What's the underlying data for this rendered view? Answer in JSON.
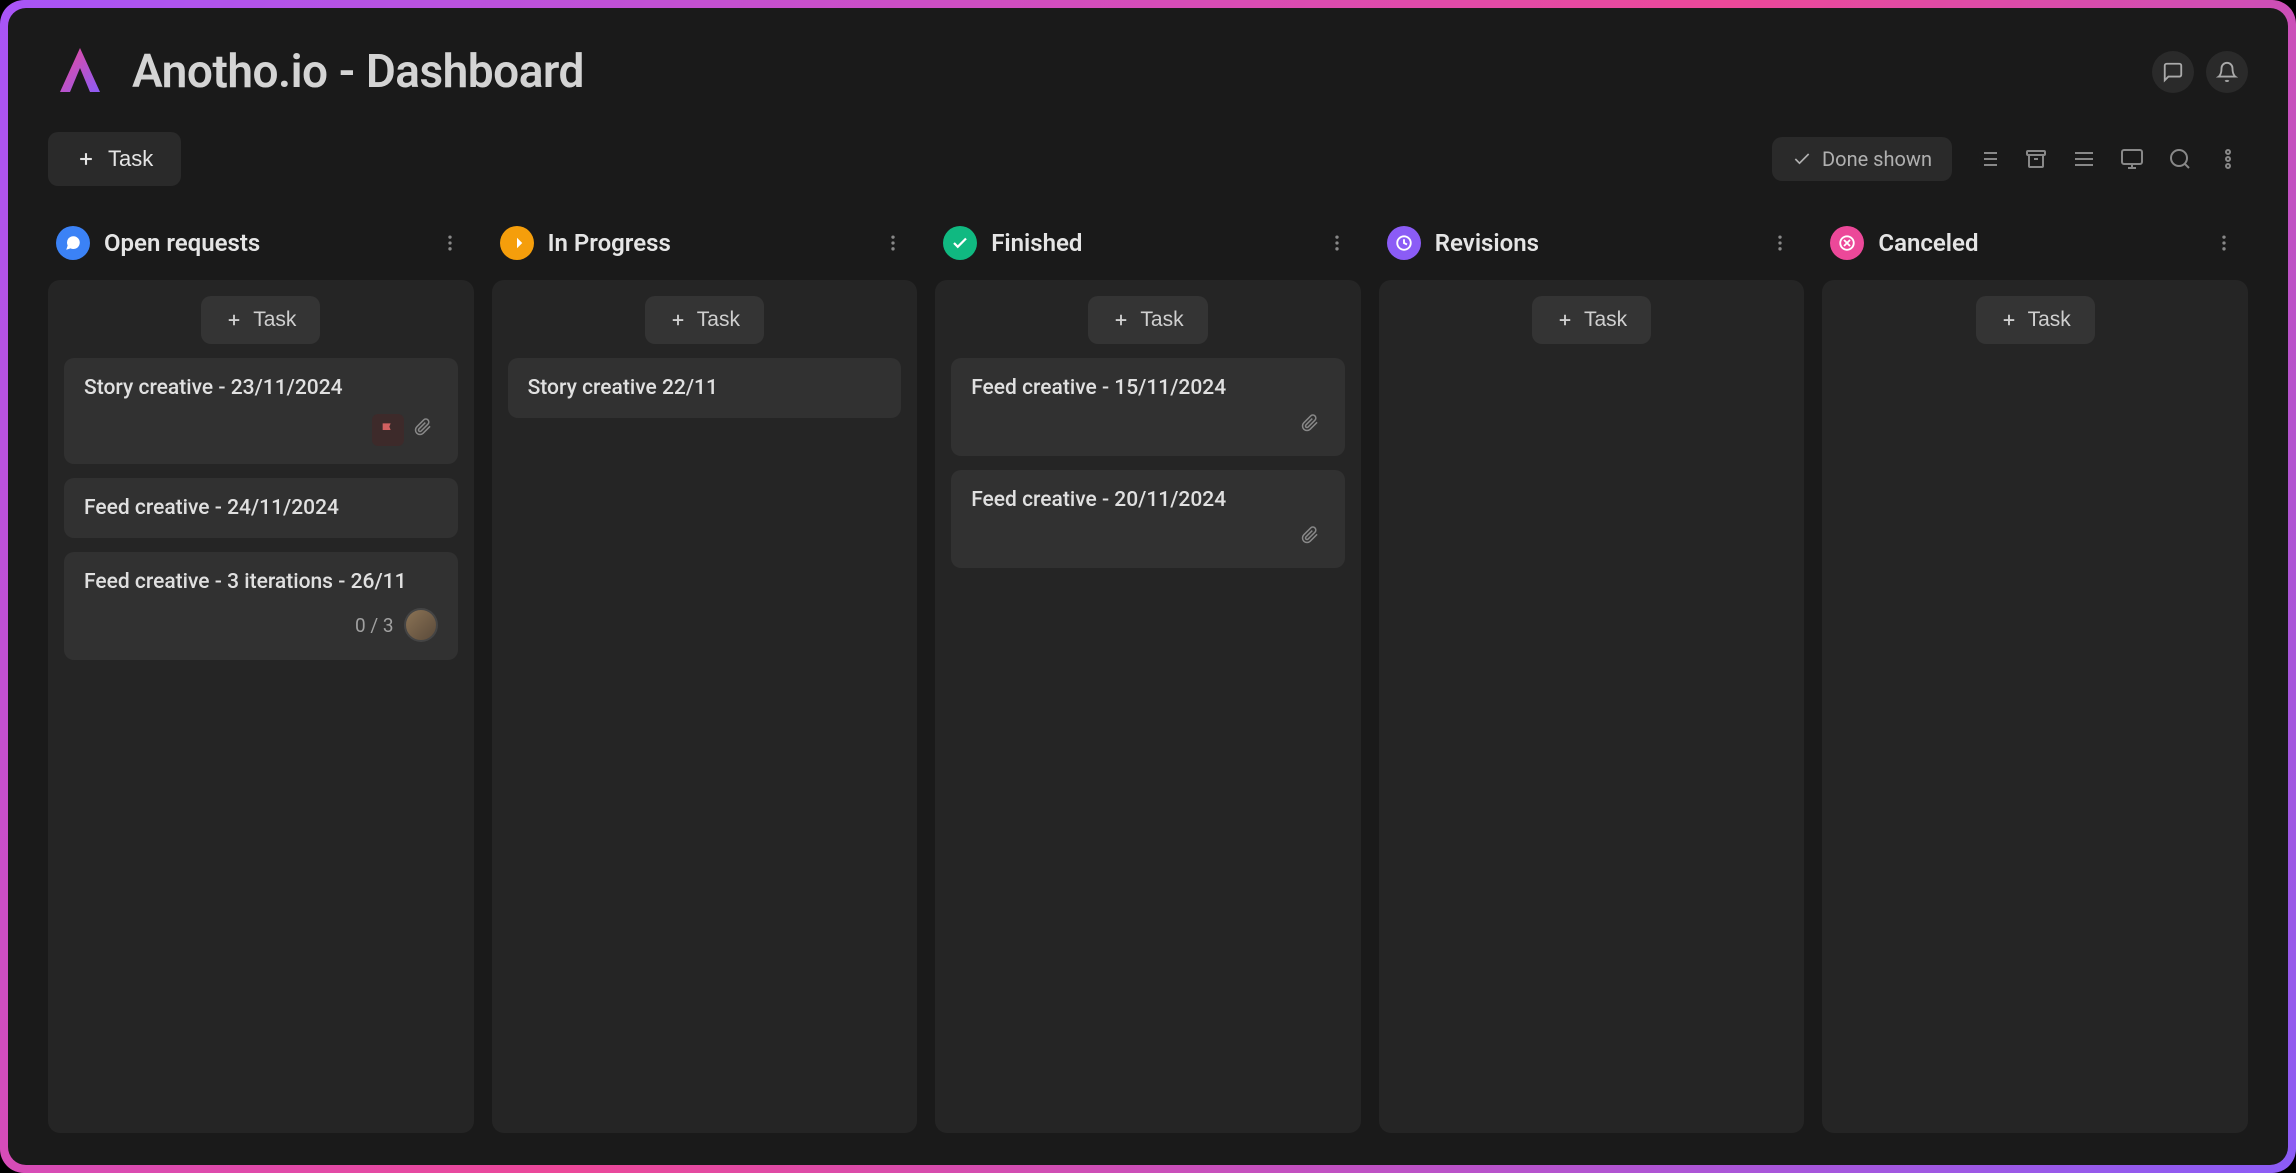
{
  "header": {
    "title": "Anotho.io - Dashboard"
  },
  "toolbar": {
    "new_task_label": "Task",
    "done_label": "Done shown"
  },
  "columns": [
    {
      "id": "open",
      "title": "Open requests",
      "color": "#3b82f6",
      "add_label": "Task",
      "cards": [
        {
          "title": "Story creative - 23/11/2024",
          "has_flag": true,
          "has_attachment": true
        },
        {
          "title": "Feed creative - 24/11/2024"
        },
        {
          "title": "Feed creative - 3 iterations - 26/11",
          "subtasks": "0 / 3",
          "has_avatar": true
        }
      ]
    },
    {
      "id": "progress",
      "title": "In Progress",
      "color": "#f59e0b",
      "add_label": "Task",
      "cards": [
        {
          "title": "Story creative 22/11"
        }
      ]
    },
    {
      "id": "finished",
      "title": "Finished",
      "color": "#10b981",
      "add_label": "Task",
      "cards": [
        {
          "title": "Feed creative - 15/11/2024",
          "has_attachment": true
        },
        {
          "title": "Feed creative - 20/11/2024",
          "has_attachment": true
        }
      ]
    },
    {
      "id": "revisions",
      "title": "Revisions",
      "color": "#8b5cf6",
      "add_label": "Task",
      "cards": []
    },
    {
      "id": "canceled",
      "title": "Canceled",
      "color": "#ec4899",
      "add_label": "Task",
      "cards": []
    }
  ]
}
